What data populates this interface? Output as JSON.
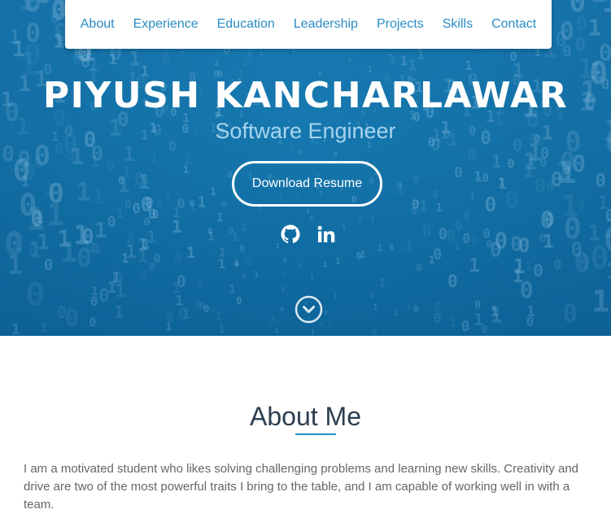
{
  "nav": {
    "items": [
      "About",
      "Experience",
      "Education",
      "Leadership",
      "Projects",
      "Skills",
      "Contact"
    ]
  },
  "hero": {
    "name": "PIYUSH KANCHARLAWAR",
    "title": "Software Engineer",
    "resume_label": "Download Resume",
    "background_texture": "binary-digits-pattern",
    "social": [
      "github-icon",
      "linkedin-icon"
    ],
    "scroll_icon": "chevron-down-icon"
  },
  "about": {
    "heading": "About Me",
    "paragraph": "I am a motivated student who likes solving challenging problems and learning new skills. Creativity and drive are two of the most powerful traits I bring to the table, and I am capable of working well in with a team."
  },
  "colors": {
    "accent": "#2a8cc4",
    "hero_bg": "#1577ad",
    "subtitle": "#a6d4ef",
    "heading": "#2c3e50",
    "body_text": "#666666"
  }
}
